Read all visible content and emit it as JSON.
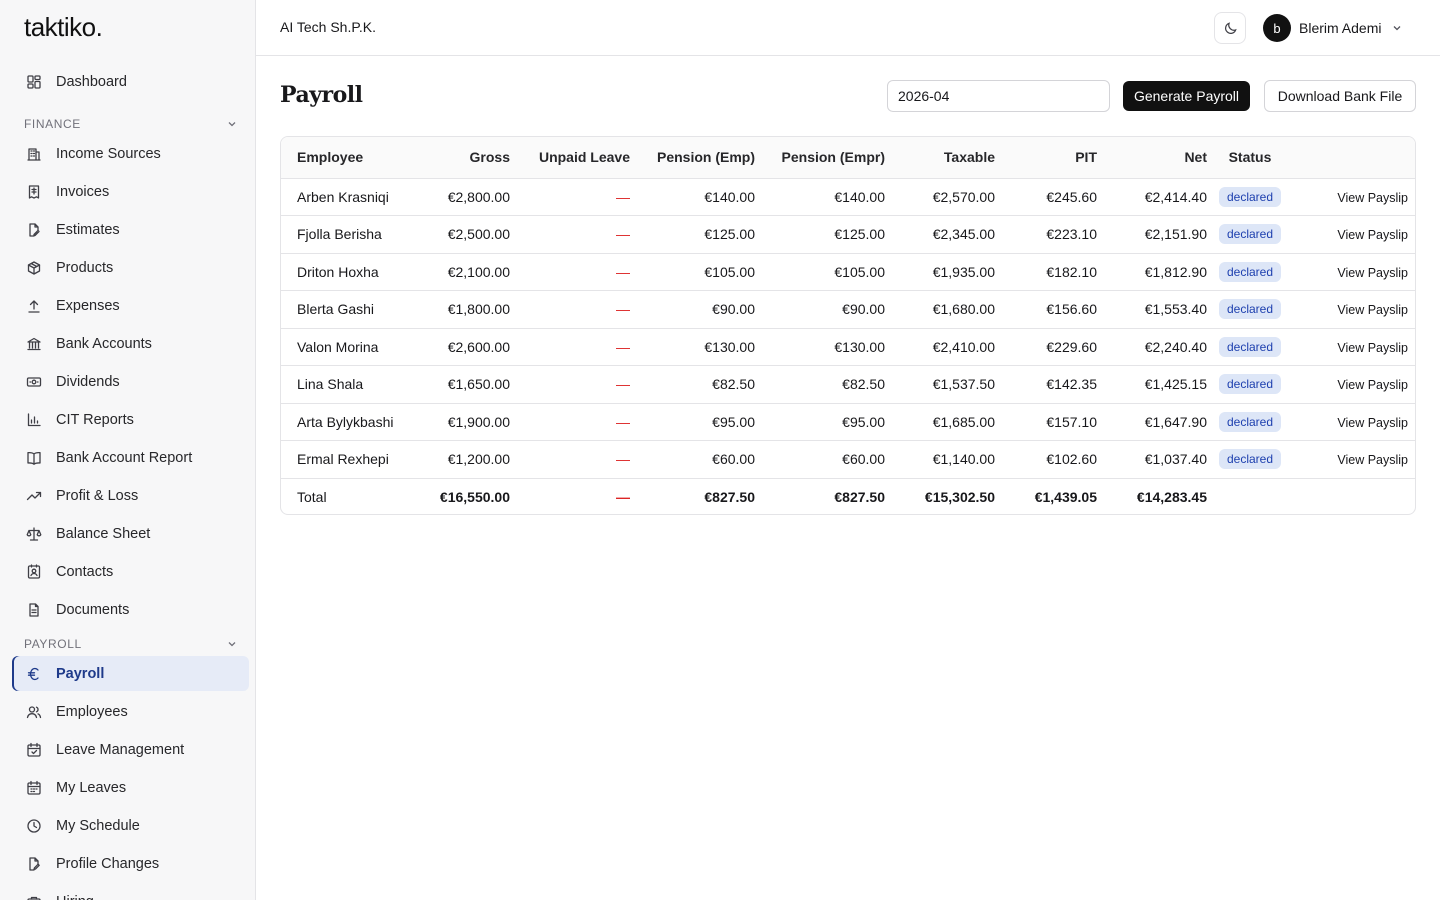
{
  "app": {
    "logo": "taktiko."
  },
  "topbar": {
    "company": "AI Tech Sh.P.K.",
    "theme_icon": "moon-icon",
    "user_initial": "b",
    "user_name": "Blerim Ademi"
  },
  "sidebar": {
    "dashboard": {
      "label": "Dashboard",
      "icon": "dashboard-icon"
    },
    "finance_label": "FINANCE",
    "finance_items": [
      {
        "label": "Income Sources",
        "icon": "building-icon"
      },
      {
        "label": "Invoices",
        "icon": "receipt-icon"
      },
      {
        "label": "Estimates",
        "icon": "file-edit-icon"
      },
      {
        "label": "Products",
        "icon": "package-icon"
      },
      {
        "label": "Expenses",
        "icon": "upload-icon"
      },
      {
        "label": "Bank Accounts",
        "icon": "bank-icon"
      },
      {
        "label": "Dividends",
        "icon": "banknote-icon"
      },
      {
        "label": "CIT Reports",
        "icon": "bar-chart-icon"
      },
      {
        "label": "Bank Account Report",
        "icon": "book-icon"
      },
      {
        "label": "Profit & Loss",
        "icon": "trending-up-icon"
      },
      {
        "label": "Balance Sheet",
        "icon": "scale-icon"
      },
      {
        "label": "Contacts",
        "icon": "contact-icon"
      },
      {
        "label": "Documents",
        "icon": "document-icon"
      }
    ],
    "payroll_label": "PAYROLL",
    "payroll_items": [
      {
        "label": "Payroll",
        "icon": "euro-icon",
        "active": true
      },
      {
        "label": "Employees",
        "icon": "users-icon"
      },
      {
        "label": "Leave Management",
        "icon": "calendar-check-icon"
      },
      {
        "label": "My Leaves",
        "icon": "calendar-icon"
      },
      {
        "label": "My Schedule",
        "icon": "clock-icon"
      },
      {
        "label": "Profile Changes",
        "icon": "file-pen-icon"
      },
      {
        "label": "Hiring",
        "icon": "briefcase-icon"
      }
    ]
  },
  "main": {
    "title": "Payroll",
    "month_value": "2026-04",
    "generate_label": "Generate Payroll",
    "download_label": "Download Bank File"
  },
  "table": {
    "headers": [
      "Employee",
      "Gross",
      "Unpaid Leave",
      "Pension (Emp)",
      "Pension (Empr)",
      "Taxable",
      "PIT",
      "Net",
      "Status",
      ""
    ],
    "rows": [
      {
        "employee": "Arben Krasniqi",
        "gross": "€2,800.00",
        "unpaid": "—",
        "pension_emp": "€140.00",
        "pension_empr": "€140.00",
        "taxable": "€2,570.00",
        "pit": "€245.60",
        "net": "€2,414.40",
        "status": "declared",
        "action": "View Payslip"
      },
      {
        "employee": "Fjolla Berisha",
        "gross": "€2,500.00",
        "unpaid": "—",
        "pension_emp": "€125.00",
        "pension_empr": "€125.00",
        "taxable": "€2,345.00",
        "pit": "€223.10",
        "net": "€2,151.90",
        "status": "declared",
        "action": "View Payslip"
      },
      {
        "employee": "Driton Hoxha",
        "gross": "€2,100.00",
        "unpaid": "—",
        "pension_emp": "€105.00",
        "pension_empr": "€105.00",
        "taxable": "€1,935.00",
        "pit": "€182.10",
        "net": "€1,812.90",
        "status": "declared",
        "action": "View Payslip"
      },
      {
        "employee": "Blerta Gashi",
        "gross": "€1,800.00",
        "unpaid": "—",
        "pension_emp": "€90.00",
        "pension_empr": "€90.00",
        "taxable": "€1,680.00",
        "pit": "€156.60",
        "net": "€1,553.40",
        "status": "declared",
        "action": "View Payslip"
      },
      {
        "employee": "Valon Morina",
        "gross": "€2,600.00",
        "unpaid": "—",
        "pension_emp": "€130.00",
        "pension_empr": "€130.00",
        "taxable": "€2,410.00",
        "pit": "€229.60",
        "net": "€2,240.40",
        "status": "declared",
        "action": "View Payslip"
      },
      {
        "employee": "Lina Shala",
        "gross": "€1,650.00",
        "unpaid": "—",
        "pension_emp": "€82.50",
        "pension_empr": "€82.50",
        "taxable": "€1,537.50",
        "pit": "€142.35",
        "net": "€1,425.15",
        "status": "declared",
        "action": "View Payslip"
      },
      {
        "employee": "Arta Bylykbashi",
        "gross": "€1,900.00",
        "unpaid": "—",
        "pension_emp": "€95.00",
        "pension_empr": "€95.00",
        "taxable": "€1,685.00",
        "pit": "€157.10",
        "net": "€1,647.90",
        "status": "declared",
        "action": "View Payslip"
      },
      {
        "employee": "Ermal Rexhepi",
        "gross": "€1,200.00",
        "unpaid": "—",
        "pension_emp": "€60.00",
        "pension_empr": "€60.00",
        "taxable": "€1,140.00",
        "pit": "€102.60",
        "net": "€1,037.40",
        "status": "declared",
        "action": "View Payslip"
      }
    ],
    "total": {
      "label": "Total",
      "gross": "€16,550.00",
      "unpaid": "—",
      "pension_emp": "€827.50",
      "pension_empr": "€827.50",
      "taxable": "€15,302.50",
      "pit": "€1,439.05",
      "net": "€14,283.45"
    }
  },
  "colors": {
    "accent": "#1e3a8a",
    "active_bg": "#e6ebf7",
    "badge_bg": "#dde6f7",
    "badge_text": "#1e40af",
    "dash": "#dc2626",
    "primary_button": "#111111"
  }
}
